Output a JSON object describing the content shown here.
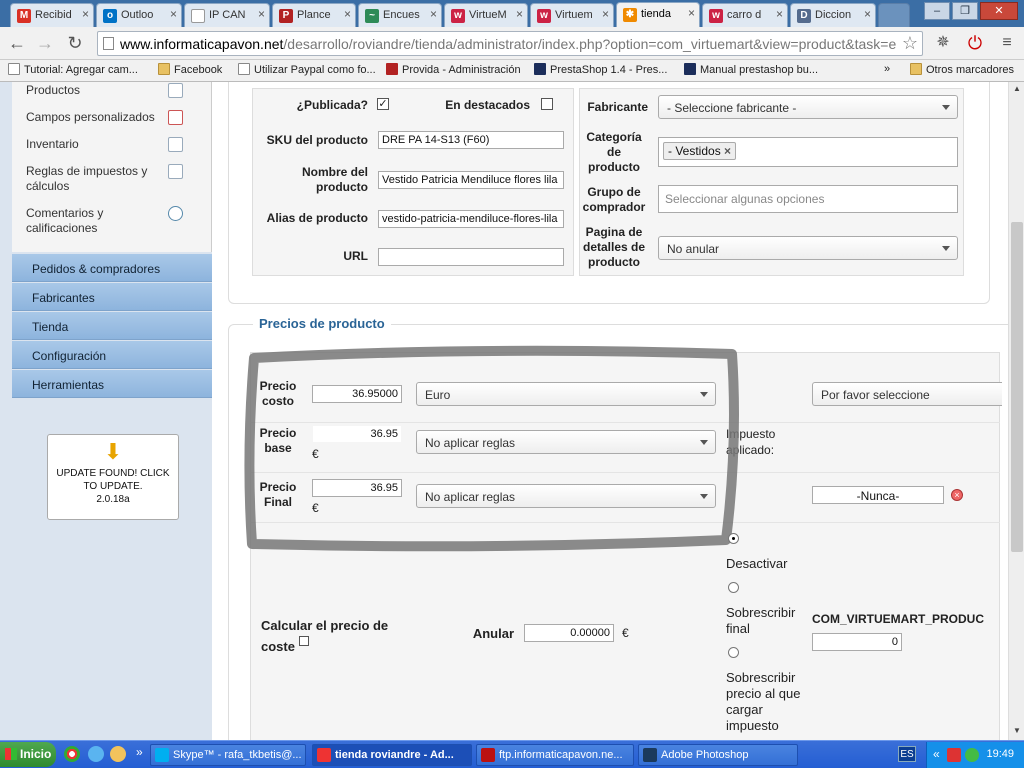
{
  "browser": {
    "tabs": [
      {
        "label": "Recibid",
        "icon": "gmail-icon",
        "color": "#d93025"
      },
      {
        "label": "Outloo",
        "icon": "outlook-icon",
        "color": "#0072c6"
      },
      {
        "label": "IP CAN",
        "icon": "page-icon",
        "color": "#ffffff"
      },
      {
        "label": "Plance",
        "icon": "provida-icon",
        "color": "#b22222"
      },
      {
        "label": "Encues",
        "icon": "survey-icon",
        "color": "#2e8b57"
      },
      {
        "label": "VirtueM",
        "icon": "virtuemart-icon",
        "color": "#cc2244"
      },
      {
        "label": "Virtuem",
        "icon": "virtuemart-icon",
        "color": "#cc2244"
      },
      {
        "label": "tienda",
        "icon": "joomla-icon",
        "color": "#f08a00"
      },
      {
        "label": "carro d",
        "icon": "shop-icon",
        "color": "#cc2244"
      },
      {
        "label": "Diccion",
        "icon": "dictionary-icon",
        "color": "#556b8d"
      }
    ],
    "url_domain": "www.informaticapavon.net",
    "url_path": "/desarrollo/roviandre/tienda/administrator/index.php?option=com_virtuemart&view=product&task=e",
    "bookmarks": [
      "Tutorial: Agregar cam...",
      "Facebook",
      "Utilizar Paypal como fo...",
      "Provida - Administración",
      "PrestaShop 1.4 - Pres...",
      "Manual prestashop bu..."
    ],
    "bookmarks_overflow": "»",
    "other_bookmarks": "Otros marcadores"
  },
  "sidebar": {
    "subitems": [
      "Productos",
      "Campos personalizados",
      "Inventario",
      "Reglas de impuestos y cálculos",
      "Comentarios y calificaciones"
    ],
    "nav": [
      "Pedidos & compradores",
      "Fabricantes",
      "Tienda",
      "Configuración",
      "Herramientas"
    ],
    "update_text": "UPDATE FOUND! CLICK TO UPDATE.",
    "update_version": "2.0.18a"
  },
  "product": {
    "published_label": "¿Publicada?",
    "featured_label": "En destacados",
    "sku_label": "SKU del producto",
    "sku_value": "DRE PA 14-S13 (F60)",
    "name_label": "Nombre del producto",
    "name_value": "Vestido Patricia Mendiluce flores lila",
    "alias_label": "Alias de producto",
    "alias_value": "vestido-patricia-mendiluce-flores-lila",
    "url_label": "URL",
    "manufacturer_label": "Fabricante",
    "manufacturer_value": "- Seleccione fabricante -",
    "category_label": "Categoría de producto",
    "category_tag": "- Vestidos",
    "shopper_label": "Grupo de comprador",
    "shopper_placeholder": "Seleccionar algunas opciones",
    "details_label": "Pagina de detalles de producto",
    "details_value": "No anular"
  },
  "prices": {
    "legend": "Precios de producto",
    "cost_label": "Precio costo",
    "cost_value": "36.95000",
    "currency": "Euro",
    "vendor_select": "Por favor seleccione",
    "base_label": "Precio base",
    "base_value": "36.95",
    "euro_sign": "€",
    "rule_none": "No aplicar reglas",
    "tax_applied": "Impuesto aplicado:",
    "final_label": "Precio Final",
    "final_value": "36.95",
    "never": "-Nunca-",
    "calc_cost_label": "Calcular el precio de coste",
    "override_label": "Anular",
    "override_value": "0.00000",
    "opt_disable": "Desactivar",
    "opt_overwrite_final": "Sobrescribir final",
    "opt_overwrite_tax": "Sobrescribir precio al que cargar impuesto",
    "const_label": "COM_VIRTUEMART_PRODUC",
    "const_value": "0"
  },
  "taskbar": {
    "start": "Inicio",
    "quick_overflow": "»",
    "tasks": [
      "Skype™ - rafa_tkbetis@...",
      "tienda roviandre - Ad...",
      "ftp.informaticapavon.ne...",
      "Adobe Photoshop"
    ],
    "lang": "ES",
    "tray_overflow": "«",
    "clock": "19:49"
  }
}
